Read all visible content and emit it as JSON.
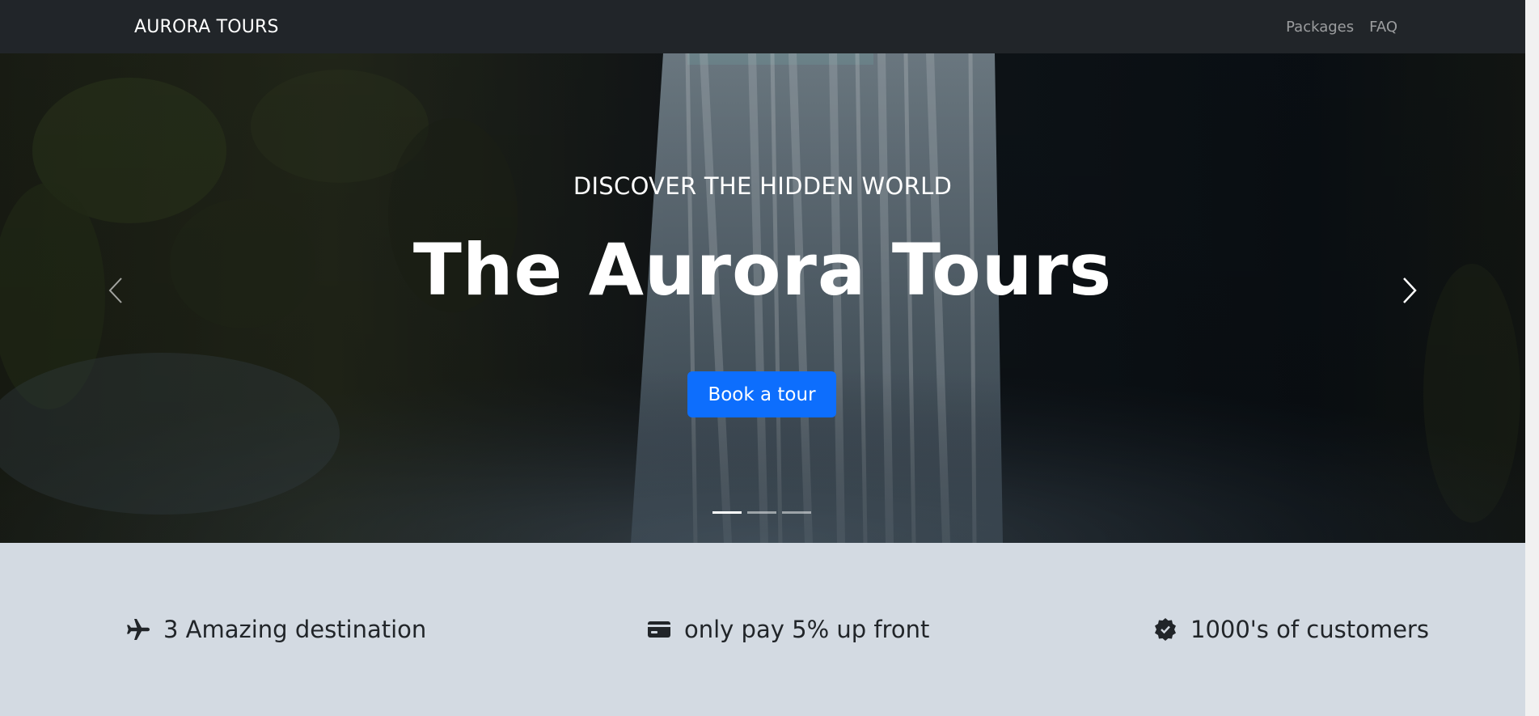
{
  "navbar": {
    "brand": "AURORA TOURS",
    "links": [
      "Packages",
      "FAQ"
    ]
  },
  "hero": {
    "subtitle": "DISCOVER THE HIDDEN WORLD",
    "title": "The Aurora Tours",
    "cta_label": "Book a tour",
    "prev_icon": "chevron-left-icon",
    "next_icon": "chevron-right-icon",
    "slide_count": 3,
    "active_slide": 1
  },
  "features": [
    {
      "icon": "airplane-icon",
      "label": "3 Amazing destination"
    },
    {
      "icon": "credit-card-icon",
      "label": "only pay 5% up front"
    },
    {
      "icon": "verified-badge-icon",
      "label": "1000's of customers"
    }
  ],
  "colors": {
    "navbar_bg": "#212529",
    "primary_button": "#0d6efd",
    "features_bg": "#d3dae2",
    "text_dark": "#212529"
  }
}
